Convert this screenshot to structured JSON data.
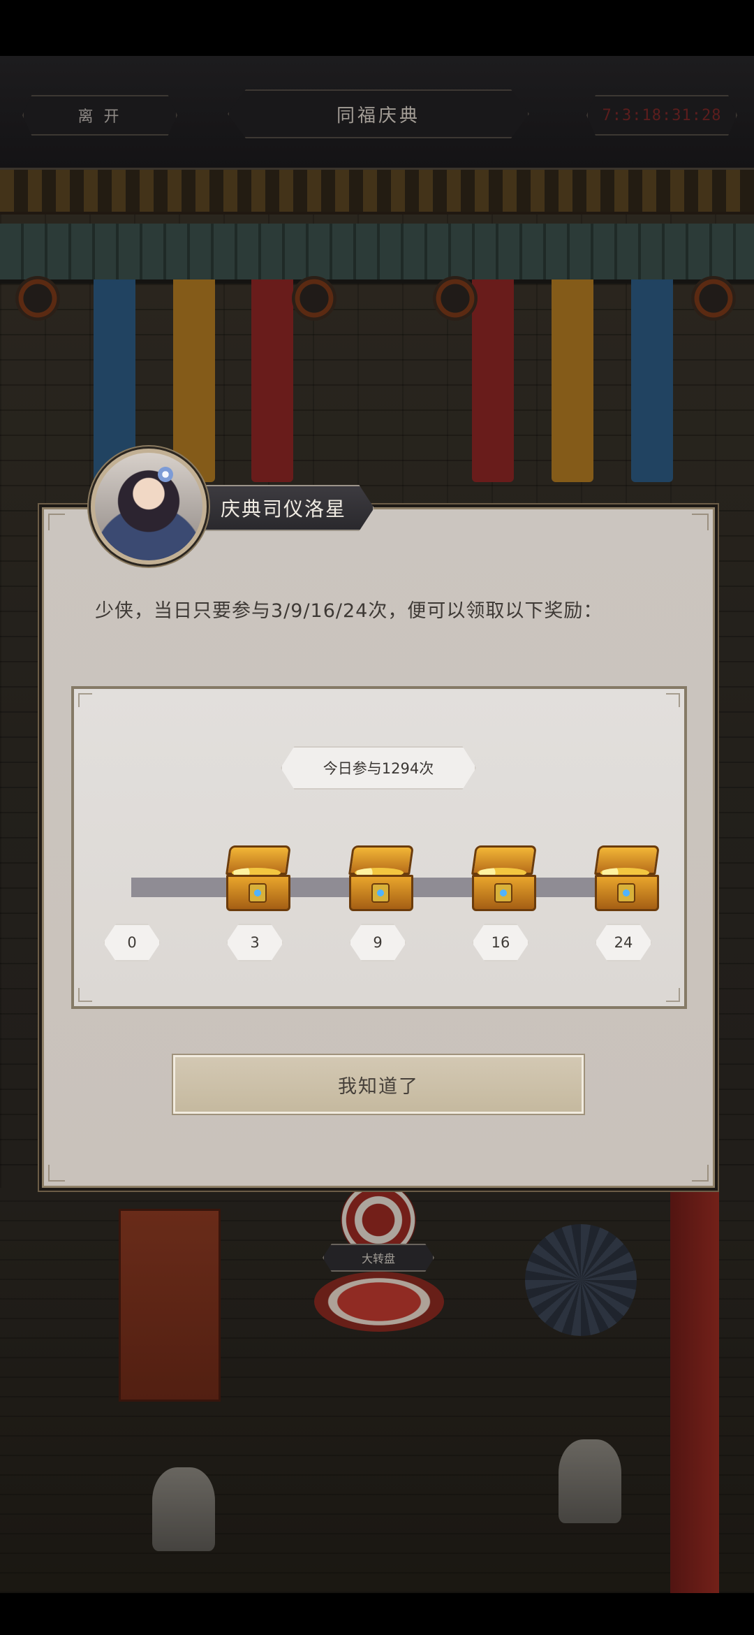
{
  "top_nav": {
    "leave_label": "离 开",
    "title": "同福庆典",
    "timer": "7:3:18:31:28"
  },
  "scene": {
    "wheel_label": "大转盘"
  },
  "dialog": {
    "npc_name": "庆典司仪洛星",
    "intro": "少侠，当日只要参与3/9/16/24次，便可以领取以下奖励：",
    "participation_count": "今日参与1294次",
    "milestones": [
      "0",
      "3",
      "9",
      "16",
      "24"
    ],
    "ok_label": "我知道了"
  },
  "colors": {
    "dialog_bg": "#cbc5bf",
    "panel_border": "#857a66",
    "track": "#8f8c94",
    "chest_gold": "#e8a52c"
  }
}
